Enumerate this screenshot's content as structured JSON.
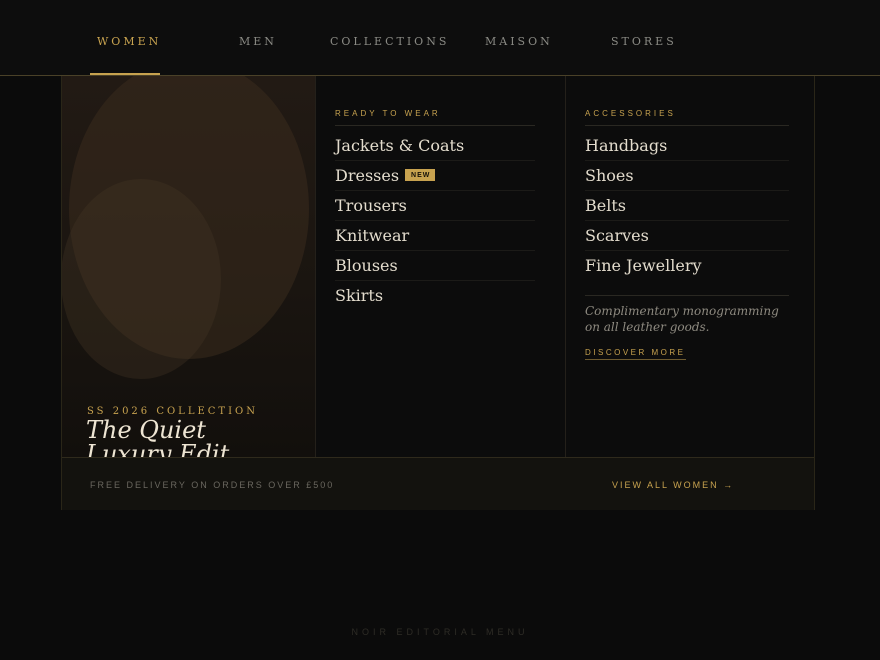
{
  "nav": {
    "items": [
      {
        "label": "WOMEN",
        "active": true
      },
      {
        "label": "MEN"
      },
      {
        "label": "COLLECTIONS"
      },
      {
        "label": "MAISON"
      },
      {
        "label": "STORES"
      }
    ]
  },
  "hero": {
    "kicker": "SS 2026 COLLECTION",
    "title_line1": "The Quiet",
    "title_line2": "Luxury Edit"
  },
  "columns": [
    {
      "heading": "READY TO WEAR",
      "items": [
        {
          "label": "Jackets & Coats"
        },
        {
          "label": "Dresses",
          "badge": "NEW"
        },
        {
          "label": "Trousers"
        },
        {
          "label": "Knitwear"
        },
        {
          "label": "Blouses"
        },
        {
          "label": "Skirts"
        }
      ]
    },
    {
      "heading": "ACCESSORIES",
      "items": [
        {
          "label": "Handbags"
        },
        {
          "label": "Shoes"
        },
        {
          "label": "Belts"
        },
        {
          "label": "Scarves"
        },
        {
          "label": "Fine Jewellery"
        }
      ],
      "promo_text": "Complimentary monogramming on all leather goods.",
      "promo_link": "DISCOVER MORE"
    }
  ],
  "footer": {
    "note": "FREE DELIVERY ON ORDERS OVER £500",
    "link": "VIEW ALL WOMEN →"
  },
  "caption": "NOIR EDITORIAL MENU",
  "colors": {
    "accent_gold": "#c7a24f",
    "background": "#0b0b0b",
    "text_primary": "#e3dccd"
  }
}
